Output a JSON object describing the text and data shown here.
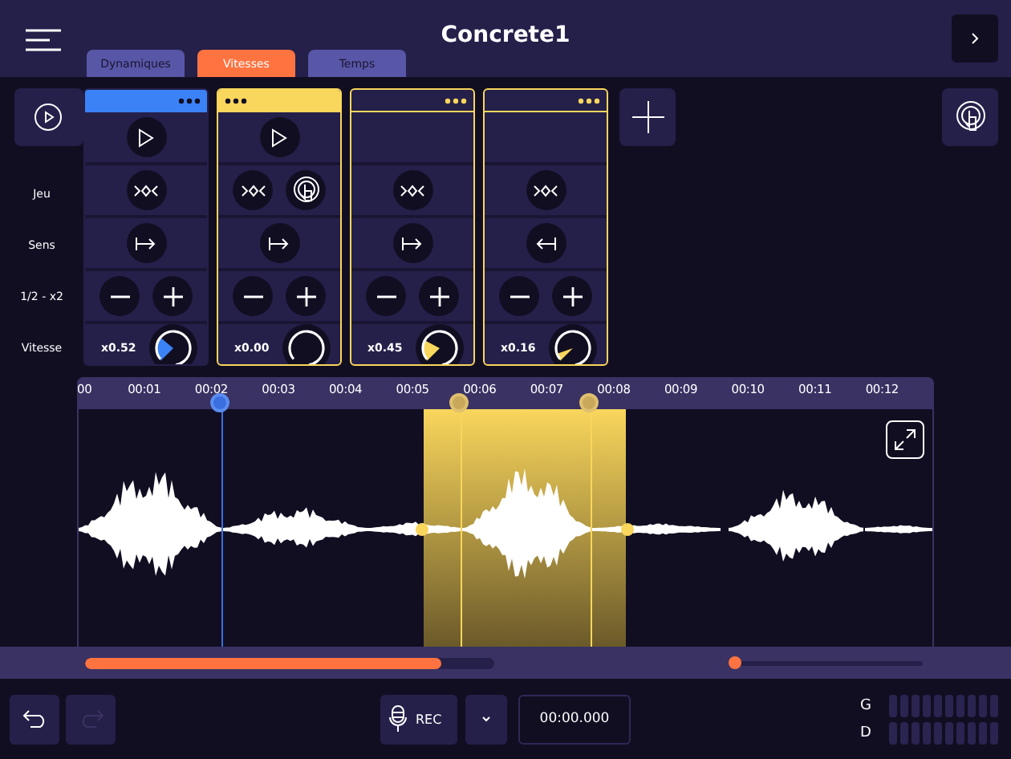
{
  "header": {
    "title": "Concrete1",
    "tabs": [
      {
        "label": "Dynamiques",
        "selected": false
      },
      {
        "label": "Vitesses",
        "selected": true
      },
      {
        "label": "Temps",
        "selected": false
      }
    ]
  },
  "row_labels": [
    "Jeu",
    "Sens",
    "1/2 - x2",
    "Vitesse"
  ],
  "cards": [
    {
      "kind": "filled",
      "color": "#3b82f6",
      "play": true,
      "touch": false,
      "reverse": false,
      "speed": "x0.52"
    },
    {
      "kind": "selected",
      "color": "#f9d65c",
      "play": true,
      "touch": true,
      "reverse": false,
      "speed": "x0.00"
    },
    {
      "kind": "outline",
      "color": "#f9d65c",
      "play": false,
      "touch": false,
      "reverse": false,
      "speed": "x0.45"
    },
    {
      "kind": "outline",
      "color": "#f9d65c",
      "play": false,
      "touch": false,
      "reverse": true,
      "speed": "x0.16"
    }
  ],
  "timeline": {
    "ticks": [
      "00",
      "00:01",
      "00:02",
      "00:03",
      "00:04",
      "00:05",
      "00:06",
      "00:07",
      "00:08",
      "00:09",
      "00:10",
      "00:11",
      "00:12"
    ]
  },
  "footer": {
    "undo_disabled": false,
    "redo_disabled": true,
    "rec_label": "REC",
    "time": "00:00.000",
    "meters": [
      {
        "label": "G"
      },
      {
        "label": "D"
      }
    ]
  }
}
